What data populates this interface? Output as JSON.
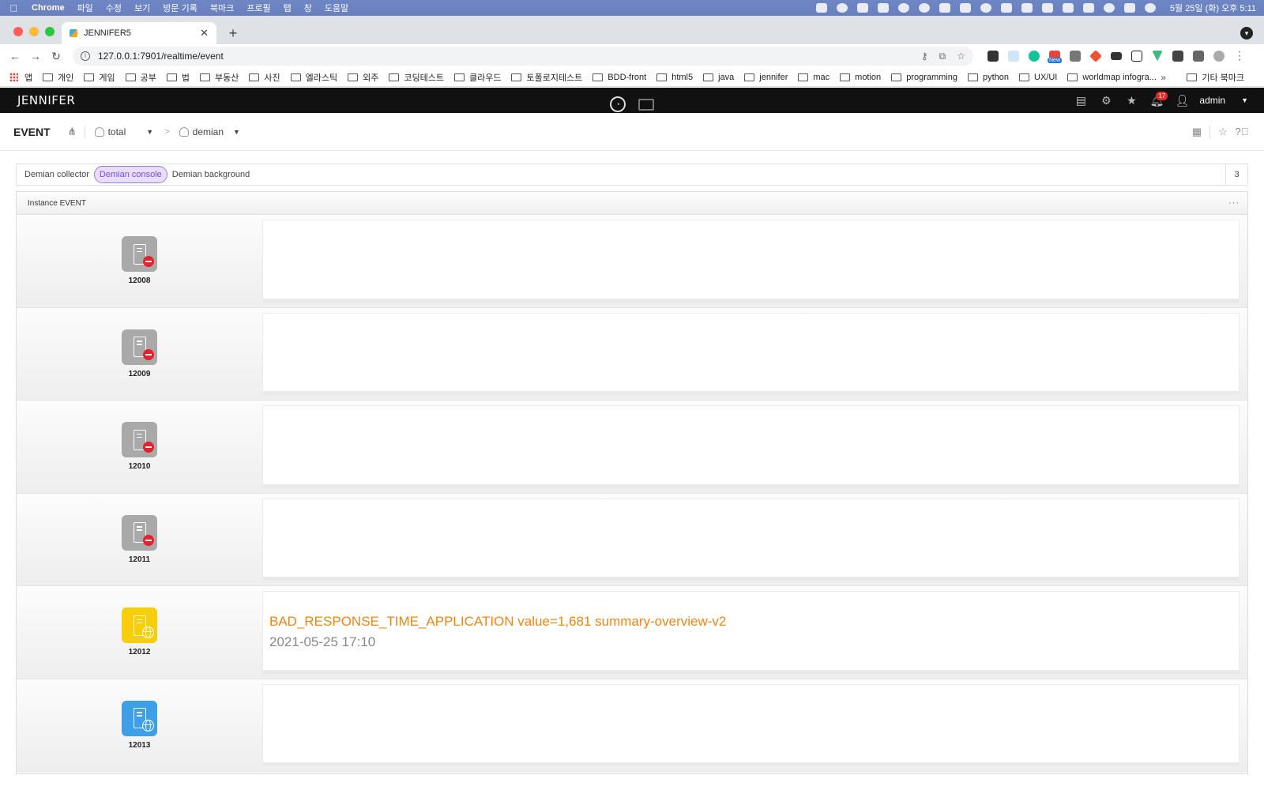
{
  "mac": {
    "app_name": "Chrome",
    "menus": [
      "파일",
      "수정",
      "보기",
      "방문 기록",
      "북마크",
      "프로필",
      "탭",
      "창",
      "도움말"
    ],
    "clock": "5월 25일 (화) 오후 5:11"
  },
  "browser": {
    "tab_title": "JENNIFER5",
    "url": "127.0.0.1:7901/realtime/event",
    "new_badge": "New"
  },
  "bookmarks": {
    "apps_label": "앱",
    "items": [
      "개인",
      "게임",
      "공부",
      "법",
      "부동산",
      "사진",
      "엘라스틱",
      "외주",
      "코딩테스트",
      "클라우드",
      "토폴로지테스트",
      "BDD-front",
      "html5",
      "java",
      "jennifer",
      "mac",
      "motion",
      "programming",
      "python",
      "UX/UI",
      "worldmap infogra..."
    ],
    "more": "»",
    "other": "기타 북마크"
  },
  "jennifer": {
    "logo": "JENNIFER",
    "notification_count": "17",
    "user": "admin"
  },
  "page": {
    "title": "EVENT",
    "breadcrumb_domain": "total",
    "breadcrumb_group": "demian"
  },
  "filters": {
    "tabs": [
      "Demian collector",
      "Demian console",
      "Demian background"
    ],
    "active_index": 1,
    "count": "3"
  },
  "panel": {
    "title": "Instance EVENT",
    "more": "···",
    "rows": [
      {
        "id": "12008",
        "status": "stopped",
        "color": "#a9a9a9",
        "event": "",
        "time": ""
      },
      {
        "id": "12009",
        "status": "stopped",
        "color": "#a9a9a9",
        "event": "",
        "time": ""
      },
      {
        "id": "12010",
        "status": "stopped",
        "color": "#a9a9a9",
        "event": "",
        "time": ""
      },
      {
        "id": "12011",
        "status": "stopped",
        "color": "#a9a9a9",
        "event": "",
        "time": ""
      },
      {
        "id": "12012",
        "status": "warning",
        "color": "#f8ce0b",
        "event": "BAD_RESPONSE_TIME_APPLICATION value=1,681 summary-overview-v2",
        "time": "2021-05-25 17:10"
      },
      {
        "id": "12013",
        "status": "normal",
        "color": "#3d9fe8",
        "event": "",
        "time": ""
      }
    ]
  },
  "colors": {
    "event_warning": "#f0840e",
    "active_tab": "#7b4fd6",
    "header_bg": "#111111"
  }
}
